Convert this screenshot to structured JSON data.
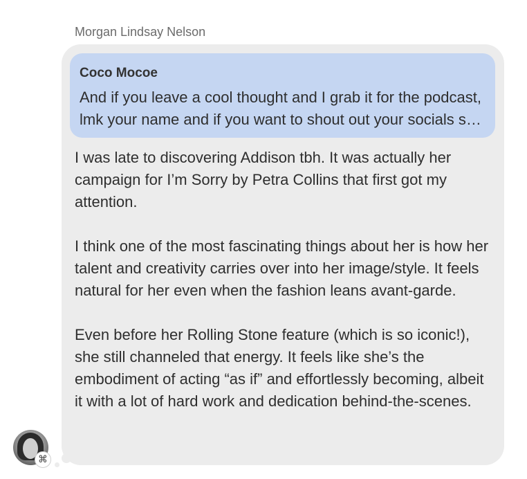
{
  "sender": {
    "name": "Morgan Lindsay Nelson"
  },
  "reply": {
    "author": "Coco Mocoe",
    "text": "And if you leave a cool thought and I grab it for the podcast, lmk your name and if you want to shout out your socials so I can credit you!"
  },
  "message": {
    "paragraphs": [
      "I was late to discovering Addison tbh. It was actually her campaign for I’m Sorry by Petra Collins that first got my attention.",
      "I think one of the most fascinating things about her is how her talent and creativity carries over into her image/style. It feels natural for her even when the fashion leans avant-garde.",
      "Even before her Rolling Stone feature (which is so iconic!), she still channeled that energy. It feels like she’s the embodiment of acting “as if” and effortlessly becoming, albeit it with a lot of hard work and dedication behind-the-scenes."
    ]
  },
  "avatar": {
    "badge_icon": "community-icon",
    "badge_glyph": "⌘"
  },
  "colors": {
    "bubble": "#ececec",
    "reply_quote": "#c5d6f2",
    "text": "#2e2e2e",
    "sender": "#6b6b6b"
  }
}
